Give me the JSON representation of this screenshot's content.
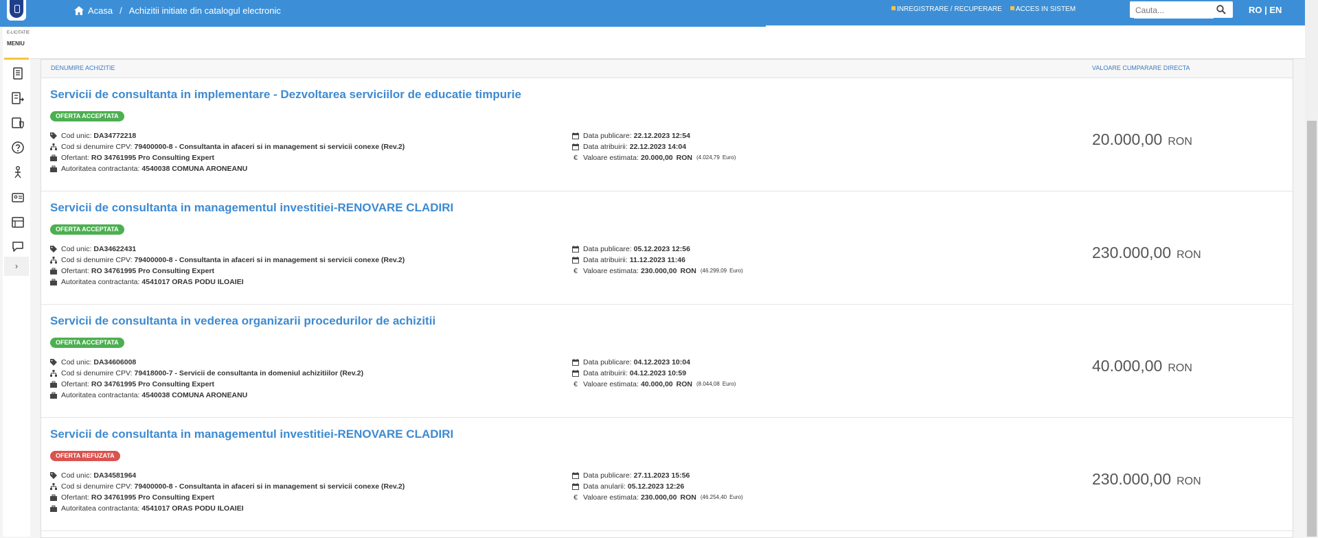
{
  "header": {
    "breadcrumb_home": "Acasa",
    "breadcrumb_sep": "/",
    "breadcrumb_current": "Achizitii initiate din catalogul electronic",
    "register_link": "INREGISTRARE / RECUPERARE",
    "login_link": "ACCES IN SISTEM",
    "search_placeholder": "Cauta...",
    "lang_switch": "RO | EN"
  },
  "sidebar": {
    "label_top": "E-LICITATIE",
    "label_menu": "MENIU",
    "expander": "›"
  },
  "table": {
    "col_name": "DENUMIRE ACHIZITIE",
    "col_value": "VALOARE CUMPARARE DIRECTA",
    "labels": {
      "cod_unic": "Cod unic:",
      "cpv": "Cod si denumire CPV:",
      "ofertant": "Ofertant:",
      "autoritate": "Autoritatea contractanta:",
      "data_publicare": "Data publicare:",
      "valoare_estimata": "Valoare estimata:"
    },
    "rows": [
      {
        "title": "Servicii de consultanta in implementare - Dezvoltarea serviciilor de educatie timpurie",
        "status": "OFERTA ACCEPTATA",
        "cod_unic": "DA34772218",
        "cpv": "79400000-8 - Consultanta in afaceri si in management si servicii conexe (Rev.2)",
        "ofertant": "RO 34761995 Pro Consulting Expert",
        "autoritate": "4540038 COMUNA ARONEANU",
        "data_publicare": "22.12.2023 12:54",
        "date2_label": "Data atribuirii:",
        "date2_value": "22.12.2023 14:04",
        "valoare_estimata": "20.000,00",
        "valoare_currency": "RON",
        "valoare_euro": "(4.024,79",
        "euro_word": "Euro)",
        "price": "20.000,00",
        "price_currency": "RON"
      },
      {
        "title": "Servicii de consultanta in managementul investitiei-RENOVARE CLADIRI",
        "status": "OFERTA ACCEPTATA",
        "cod_unic": "DA34622431",
        "cpv": "79400000-8 - Consultanta in afaceri si in management si servicii conexe (Rev.2)",
        "ofertant": "RO 34761995 Pro Consulting Expert",
        "autoritate": "4541017 ORAS PODU ILOAIEI",
        "data_publicare": "05.12.2023 12:56",
        "date2_label": "Data atribuirii:",
        "date2_value": "11.12.2023 11:46",
        "valoare_estimata": "230.000,00",
        "valoare_currency": "RON",
        "valoare_euro": "(46.299,09",
        "euro_word": "Euro)",
        "price": "230.000,00",
        "price_currency": "RON"
      },
      {
        "title": "Servicii de consultanta in vederea organizarii procedurilor de achizitii",
        "status": "OFERTA ACCEPTATA",
        "cod_unic": "DA34606008",
        "cpv": "79418000-7 - Servicii de consultanta in domeniul achizitiilor (Rev.2)",
        "ofertant": "RO 34761995 Pro Consulting Expert",
        "autoritate": "4540038 COMUNA ARONEANU",
        "data_publicare": "04.12.2023 10:04",
        "date2_label": "Data atribuirii:",
        "date2_value": "04.12.2023 10:59",
        "valoare_estimata": "40.000,00",
        "valoare_currency": "RON",
        "valoare_euro": "(8.044,08",
        "euro_word": "Euro)",
        "price": "40.000,00",
        "price_currency": "RON"
      },
      {
        "title": "Servicii de consultanta in managementul investitiei-RENOVARE CLADIRI",
        "status": "OFERTA REFUZATA",
        "cod_unic": "DA34581964",
        "cpv": "79400000-8 - Consultanta in afaceri si in management si servicii conexe (Rev.2)",
        "ofertant": "RO 34761995 Pro Consulting Expert",
        "autoritate": "4541017 ORAS PODU ILOAIEI",
        "data_publicare": "27.11.2023 15:56",
        "date2_label": "Data anularii:",
        "date2_value": "05.12.2023 12:26",
        "valoare_estimata": "230.000,00",
        "valoare_currency": "RON",
        "valoare_euro": "(46.254,40",
        "euro_word": "Euro)",
        "price": "230.000,00",
        "price_currency": "RON"
      }
    ]
  },
  "colors": {
    "brand_blue": "#3c8fd6",
    "accepted": "#4caf50",
    "refused": "#d9534f",
    "accent": "#f6c343"
  }
}
